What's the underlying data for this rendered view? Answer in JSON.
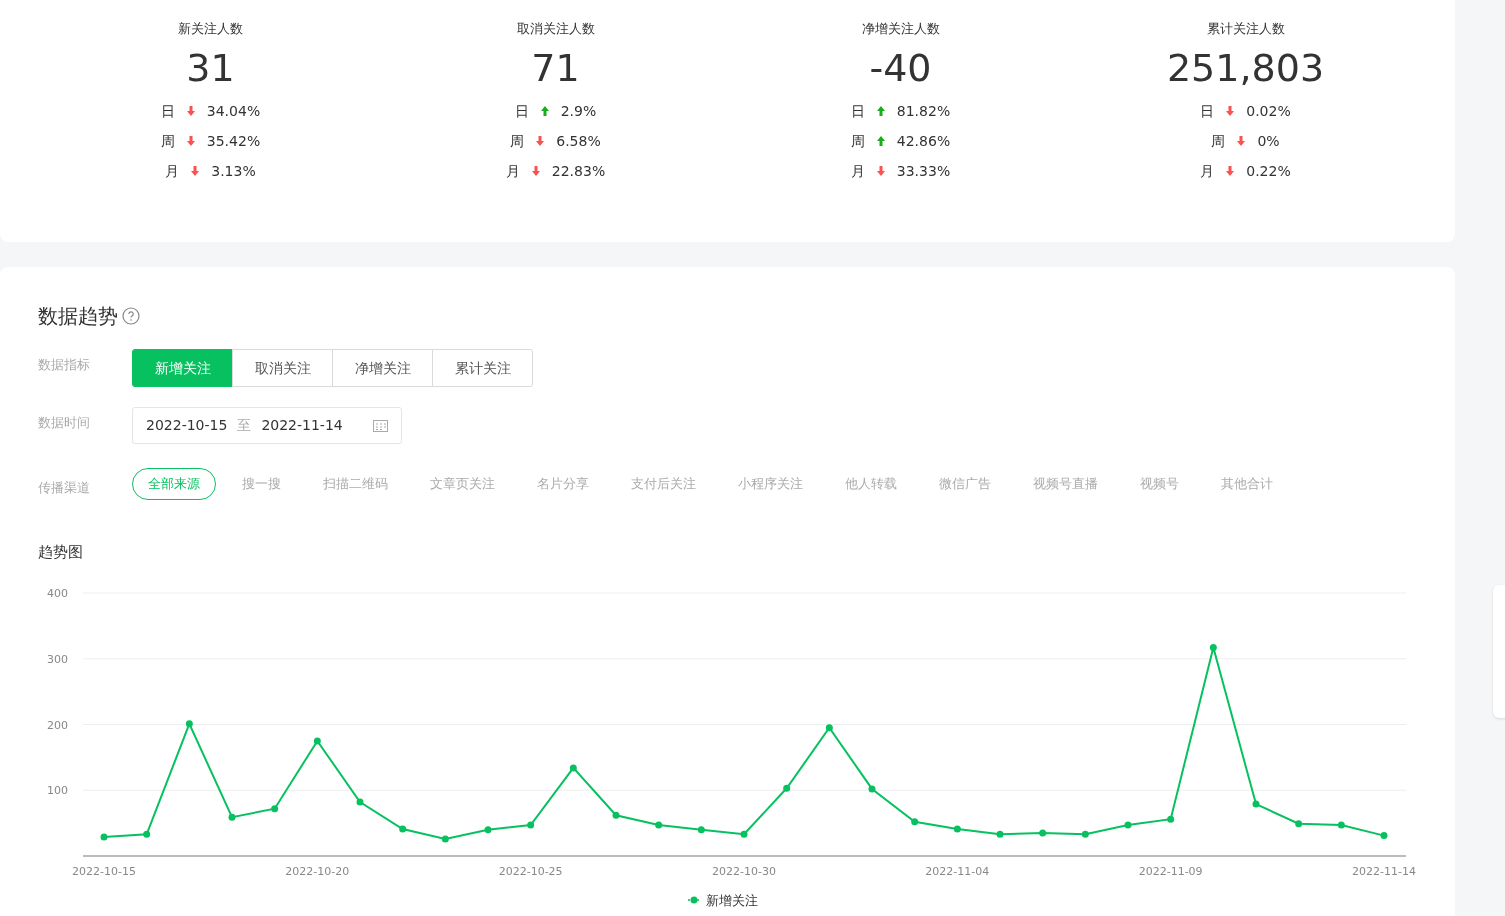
{
  "stats": [
    {
      "title": "新关注人数",
      "value": "31",
      "changes": [
        {
          "period": "日",
          "rising": false,
          "percent": "34.04%"
        },
        {
          "period": "周",
          "rising": false,
          "percent": "35.42%"
        },
        {
          "period": "月",
          "rising": false,
          "percent": "3.13%"
        }
      ]
    },
    {
      "title": "取消关注人数",
      "value": "71",
      "changes": [
        {
          "period": "日",
          "rising": true,
          "percent": "2.9%"
        },
        {
          "period": "周",
          "rising": false,
          "percent": "6.58%"
        },
        {
          "period": "月",
          "rising": false,
          "percent": "22.83%"
        }
      ]
    },
    {
      "title": "净增关注人数",
      "value": "-40",
      "changes": [
        {
          "period": "日",
          "rising": true,
          "percent": "81.82%"
        },
        {
          "period": "周",
          "rising": true,
          "percent": "42.86%"
        },
        {
          "period": "月",
          "rising": false,
          "percent": "33.33%"
        }
      ]
    },
    {
      "title": "累计关注人数",
      "value": "251,803",
      "changes": [
        {
          "period": "日",
          "rising": false,
          "percent": "0.02%"
        },
        {
          "period": "周",
          "rising": false,
          "percent": "0%"
        },
        {
          "period": "月",
          "rising": false,
          "percent": "0.22%"
        }
      ]
    }
  ],
  "trend": {
    "title": "数据趋势",
    "metric": {
      "label": "数据指标",
      "options": [
        {
          "label": "新增关注",
          "selected": true
        },
        {
          "label": "取消关注",
          "selected": false
        },
        {
          "label": "净增关注",
          "selected": false
        },
        {
          "label": "累计关注",
          "selected": false
        }
      ]
    },
    "date": {
      "label": "数据时间",
      "start": "2022-10-15",
      "separator": "至",
      "end": "2022-11-14"
    },
    "channels": {
      "label": "传播渠道",
      "options": [
        {
          "label": "全部来源",
          "selected": true
        },
        {
          "label": "搜一搜",
          "selected": false
        },
        {
          "label": "扫描二维码",
          "selected": false
        },
        {
          "label": "文章页关注",
          "selected": false
        },
        {
          "label": "名片分享",
          "selected": false
        },
        {
          "label": "支付后关注",
          "selected": false
        },
        {
          "label": "小程序关注",
          "selected": false
        },
        {
          "label": "他人转载",
          "selected": false
        },
        {
          "label": "微信广告",
          "selected": false
        },
        {
          "label": "视频号直播",
          "selected": false
        },
        {
          "label": "视频号",
          "selected": false
        },
        {
          "label": "其他合计",
          "selected": false
        }
      ]
    },
    "chart_title": "趋势图",
    "chart_data": {
      "type": "line",
      "grid": true,
      "categories": [
        "2022-10-15",
        null,
        null,
        null,
        null,
        "2022-10-20",
        null,
        null,
        null,
        null,
        "2022-10-25",
        null,
        null,
        null,
        null,
        "2022-10-30",
        null,
        null,
        null,
        null,
        "2022-11-04",
        null,
        null,
        null,
        null,
        "2022-11-09",
        null,
        null,
        null,
        null,
        "2022-11-14"
      ],
      "series": [
        {
          "name": "新增关注",
          "color": "#07c160",
          "marker": "circle",
          "values": [
            29,
            33,
            201,
            59,
            72,
            175,
            82,
            41,
            26,
            40,
            47,
            134,
            62,
            47,
            40,
            33,
            103,
            195,
            102,
            52,
            41,
            33,
            35,
            33,
            47,
            56,
            317,
            79,
            49,
            47,
            31
          ]
        }
      ],
      "ylim": [
        0,
        400
      ],
      "yticks": [
        100,
        200,
        300,
        400
      ]
    }
  }
}
